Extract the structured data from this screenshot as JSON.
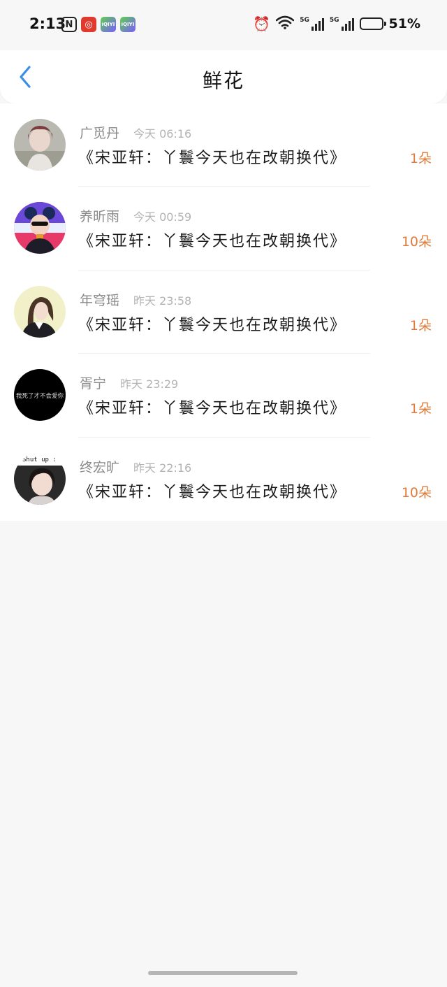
{
  "status_bar": {
    "time": "2:13",
    "left_icons": [
      "nfc-icon",
      "netease-music-icon",
      "iqiyi-icon",
      "iqiyi-icon"
    ],
    "nfc_label": "N",
    "netease_label": "◎",
    "iqiyi_label": "iQIYI",
    "alarm_glyph": "⏰",
    "wifi_glyph": "≋",
    "network_1": "5G",
    "network_2": "5G",
    "battery_percent": 51,
    "battery_text": "51%"
  },
  "header": {
    "title": "鲜花",
    "back_icon": "chevron-left-icon",
    "accent_color": "#3a8ee6"
  },
  "list": {
    "items": [
      {
        "name": "广觅丹",
        "time": "今天 06:16",
        "title": "《宋亚轩：丫鬟今天也在改朝换代》",
        "count": "1朵",
        "avatar": "avatar-1"
      },
      {
        "name": "养昕雨",
        "time": "今天 00:59",
        "title": "《宋亚轩：丫鬟今天也在改朝换代》",
        "count": "10朵",
        "avatar": "avatar-2"
      },
      {
        "name": "年穹瑶",
        "time": "昨天 23:58",
        "title": "《宋亚轩：丫鬟今天也在改朝换代》",
        "count": "1朵",
        "avatar": "avatar-3"
      },
      {
        "name": "胥宁",
        "time": "昨天 23:29",
        "title": "《宋亚轩：丫鬟今天也在改朝换代》",
        "count": "1朵",
        "avatar": "avatar-4",
        "avatar_text": "我死了才不会爱你"
      },
      {
        "name": "终宏旷",
        "time": "昨天 22:16",
        "title": "《宋亚轩：丫鬟今天也在改朝换代》",
        "count": "10朵",
        "avatar": "avatar-5",
        "avatar_text": "Shut up :"
      }
    ]
  },
  "colors": {
    "count": "#e07b3a",
    "name": "#8a8a8a",
    "time": "#b3b3b3",
    "background": "#f8f7f7"
  }
}
